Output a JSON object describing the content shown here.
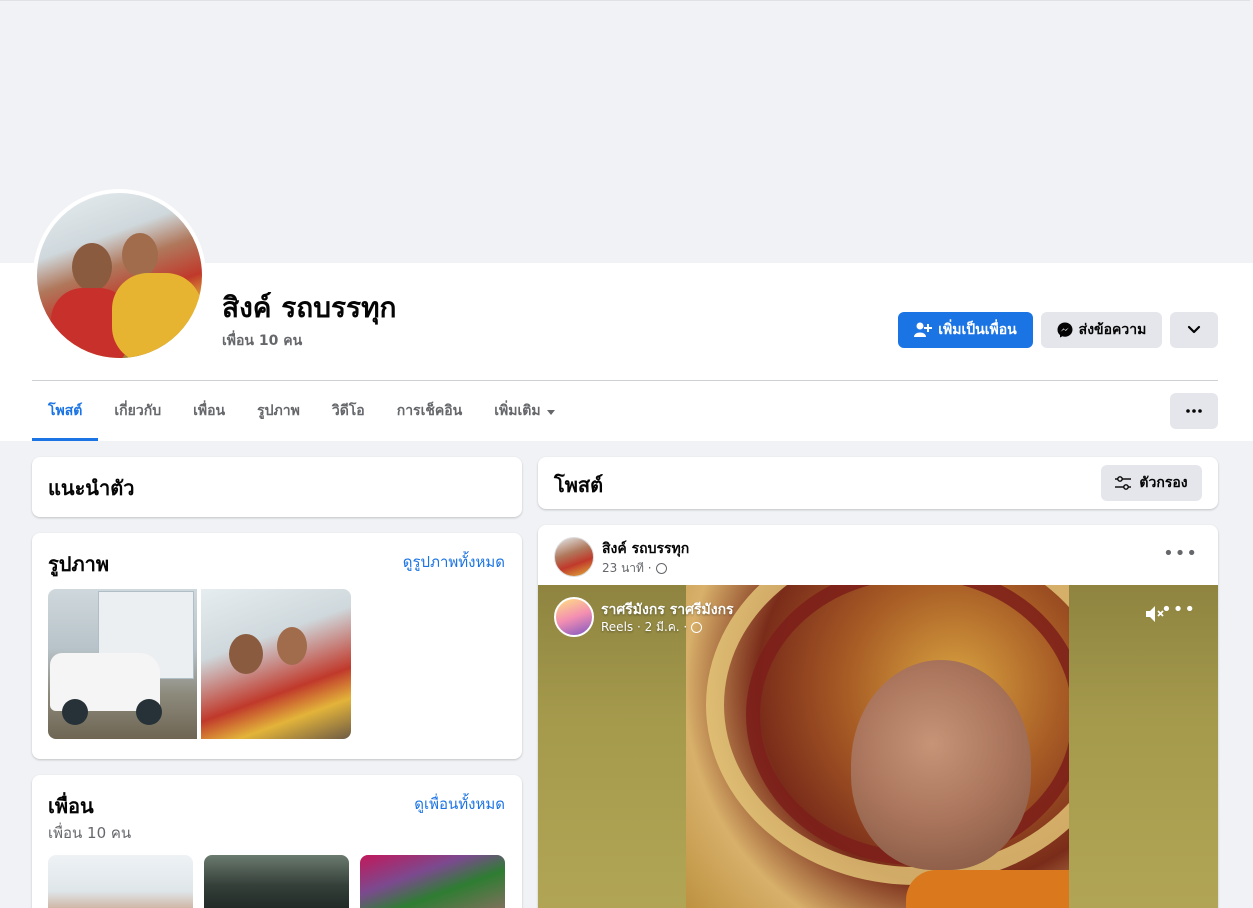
{
  "profile": {
    "name": "สิงค์ รถบรรทุก",
    "friends_count_text": "เพื่อน 10 คน"
  },
  "actions": {
    "add_friend_label": "เพิ่มเป็นเพื่อน",
    "message_label": "ส่งข้อความ"
  },
  "tabs": [
    {
      "label": "โพสต์",
      "active": true
    },
    {
      "label": "เกี่ยวกับ",
      "active": false
    },
    {
      "label": "เพื่อน",
      "active": false
    },
    {
      "label": "รูปภาพ",
      "active": false
    },
    {
      "label": "วิดีโอ",
      "active": false
    },
    {
      "label": "การเช็คอิน",
      "active": false
    },
    {
      "label": "เพิ่มเติม",
      "active": false
    }
  ],
  "intro": {
    "title": "แนะนำตัว"
  },
  "photos": {
    "title": "รูปภาพ",
    "see_all": "ดูรูปภาพทั้งหมด"
  },
  "friends": {
    "title": "เพื่อน",
    "count_text": "เพื่อน 10 คน",
    "see_all": "ดูเพื่อนทั้งหมด"
  },
  "posts": {
    "title": "โพสต์",
    "filter_label": "ตัวกรอง"
  },
  "post": {
    "author": "สิงค์ รถบรรทุก",
    "time": "23 นาที ·",
    "shared": {
      "author": "ราศรีมังกร ราศรีมังกร",
      "meta": "Reels · 2 มี.ค. ·"
    }
  },
  "colors": {
    "accent": "#1b74e4",
    "page_bg": "#f0f2f5",
    "secondary_button": "#e4e6eb",
    "muted_text": "#65676b"
  }
}
